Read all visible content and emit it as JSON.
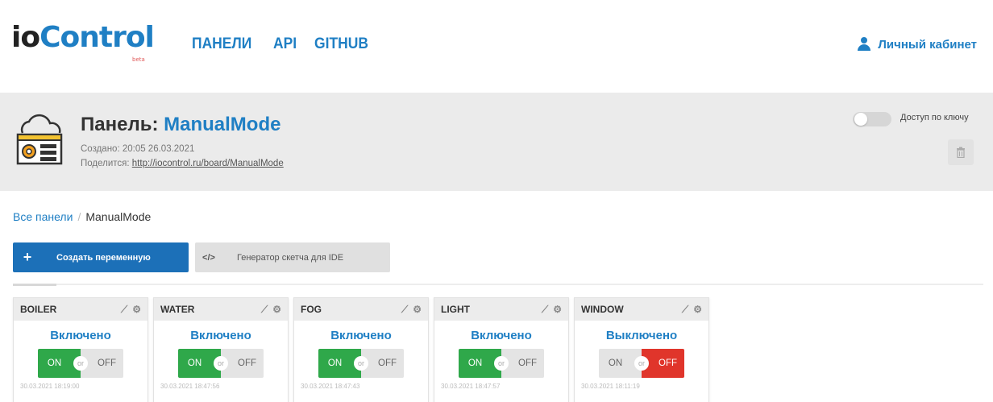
{
  "nav": {
    "logo_io": "io",
    "logo_control": "Control",
    "logo_beta": "beta",
    "links": [
      "ПАНЕЛИ",
      "API",
      "GITHUB"
    ],
    "account": "Личный кабинет"
  },
  "board": {
    "title_prefix": "Панель: ",
    "title_name": "ManualMode",
    "created": "Создано: 20:05 26.03.2021",
    "share_label": "Поделится: ",
    "share_link": "http://iocontrol.ru/board/ManualMode",
    "key_access_label": "Доступ по ключу",
    "key_access_enabled": false
  },
  "breadcrumb": {
    "all": "Все панели",
    "sep": "/",
    "current": "ManualMode"
  },
  "actions": {
    "create_icon": "+",
    "create_label": "Создать переменную",
    "generator_icon": "</>",
    "generator_label": "Генератор скетча для IDE"
  },
  "switch_labels": {
    "on": "ON",
    "or": "or",
    "off": "OFF"
  },
  "widgets": [
    {
      "name": "BOILER",
      "status": "Включено",
      "state": "on",
      "timestamp": "30.03.2021 18:19:00"
    },
    {
      "name": "WATER",
      "status": "Включено",
      "state": "on",
      "timestamp": "30.03.2021 18:47:56"
    },
    {
      "name": "FOG",
      "status": "Включено",
      "state": "on",
      "timestamp": "30.03.2021 18:47:43"
    },
    {
      "name": "LIGHT",
      "status": "Включено",
      "state": "on",
      "timestamp": "30.03.2021 18:47:57"
    },
    {
      "name": "WINDOW",
      "status": "Выключено",
      "state": "off",
      "timestamp": "30.03.2021 18:11:19"
    }
  ],
  "colors": {
    "brand_blue": "#1f7fc4",
    "on_green": "#2fa84a",
    "off_red": "#e0352b"
  }
}
